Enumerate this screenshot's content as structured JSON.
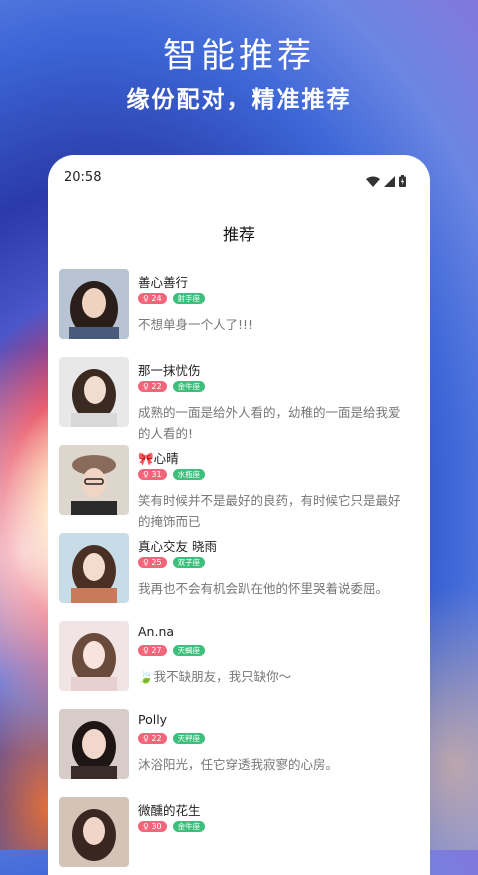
{
  "hero": {
    "title": "智能推荐",
    "subtitle": "缘份配对，精准推荐"
  },
  "status_bar": {
    "time": "20:58",
    "icons": [
      "wifi-icon",
      "signal-icon",
      "battery-icon"
    ]
  },
  "page": {
    "title": "推荐"
  },
  "colors": {
    "age_badge": "#f2657a",
    "zodiac_badge": "#3dbf7c"
  },
  "users": [
    {
      "name": "善心善行",
      "age": "♀ 24",
      "zodiac": "射手座",
      "bio": "不想单身一个人了!!!"
    },
    {
      "name": "那一抹忧伤",
      "age": "♀ 22",
      "zodiac": "金牛座",
      "bio": "成熟的一面是给外人看的，幼稚的一面是给我爱的人看的!"
    },
    {
      "name": "🎀心晴",
      "age": "♀ 31",
      "zodiac": "水瓶座",
      "bio": "笑有时候并不是最好的良药，有时候它只是最好的掩饰而已"
    },
    {
      "name": "真心交友 晓雨",
      "age": "♀ 25",
      "zodiac": "双子座",
      "bio": "我再也不会有机会趴在他的怀里哭着说委屈。"
    },
    {
      "name": "An.na",
      "age": "♀ 27",
      "zodiac": "天蝎座",
      "bio": "🍃我不缺朋友，我只缺你～"
    },
    {
      "name": "Polly",
      "age": "♀ 22",
      "zodiac": "天秤座",
      "bio": "沐浴阳光，任它穿透我寂寥的心房。"
    },
    {
      "name": "微醺的花生",
      "age": "♀ 30",
      "zodiac": "金牛座",
      "bio": ""
    }
  ]
}
